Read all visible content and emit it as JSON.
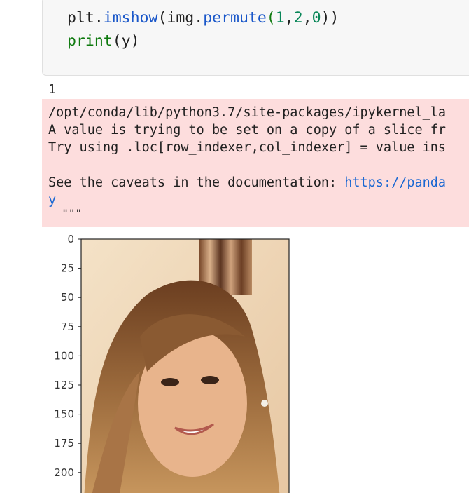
{
  "code_cell": {
    "lines": [
      {
        "a": "plt.",
        "fn": "imshow",
        "b": "(img.",
        "fn2": "permute",
        "c": "(",
        "n1": "1",
        "s1": ",",
        "n2": "2",
        "s2": ",",
        "n3": "0",
        "d": "))"
      },
      {
        "builtin": "print",
        "rest": "(y)"
      }
    ]
  },
  "output": {
    "stdout": "1",
    "stderr": {
      "line1": "/opt/conda/lib/python3.7/site-packages/ipykernel_la",
      "line2": "A value is trying to be set on a copy of a slice fr",
      "line3": "Try using .loc[row_indexer,col_indexer] = value ins",
      "line4_prefix": "See the caveats in the documentation: ",
      "line4_link": "https://panda",
      "line5_link": "y",
      "line6": "  \"\"\""
    }
  },
  "plot": {
    "y_ticks": [
      "0",
      "25",
      "50",
      "75",
      "100",
      "125",
      "150",
      "175",
      "200"
    ],
    "image_description": "portrait photo"
  }
}
